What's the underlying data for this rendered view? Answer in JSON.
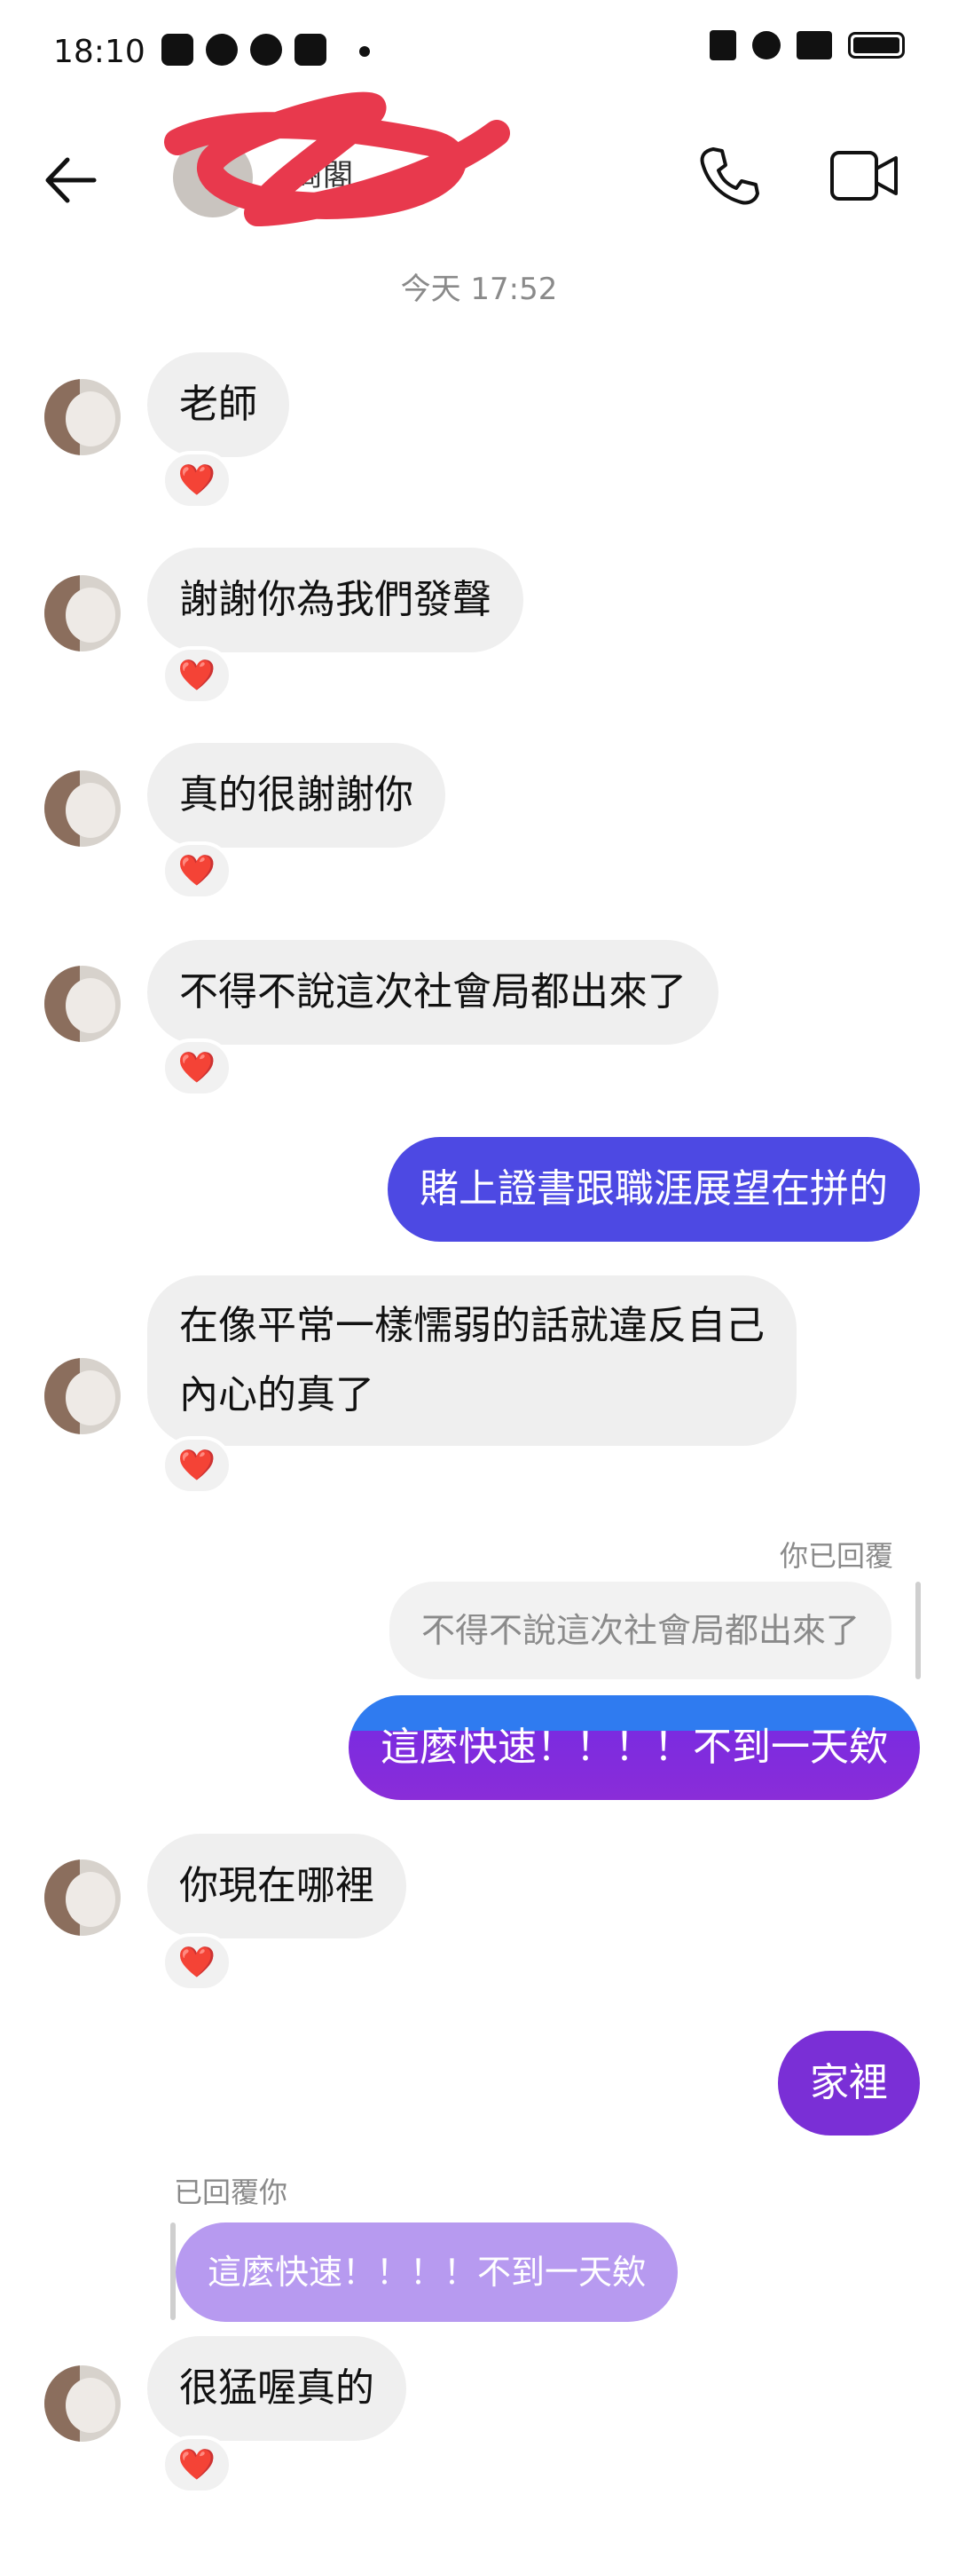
{
  "status_bar": {
    "time": "18:10"
  },
  "header": {
    "contact_name": "商閣"
  },
  "timestamp": "今天 17:52",
  "messages": {
    "m1": "老師",
    "m2": "謝謝你為我們發聲",
    "m3": "真的很謝謝你",
    "m4": "不得不說這次社會局都出來了",
    "m5": "賭上證書跟職涯展望在拼的",
    "m6": "在像平常一樣懦弱的話就違反自己內心的真了",
    "reply_label_out": "你已回覆",
    "quoted_out": "不得不說這次社會局都出來了",
    "m7": "這麼快速！！！！不到一天欸",
    "m8": "你現在哪裡",
    "m9": "家裡",
    "reply_label_in": "已回覆你",
    "quoted_in": "這麼快速！！！！不到一天欸",
    "m10": "很猛喔真的"
  },
  "reaction": "❤️",
  "colors": {
    "outgoing": "#4d49e3",
    "incoming": "#efefef",
    "purple": "#7a2fd6",
    "scribble": "#e8394d"
  }
}
